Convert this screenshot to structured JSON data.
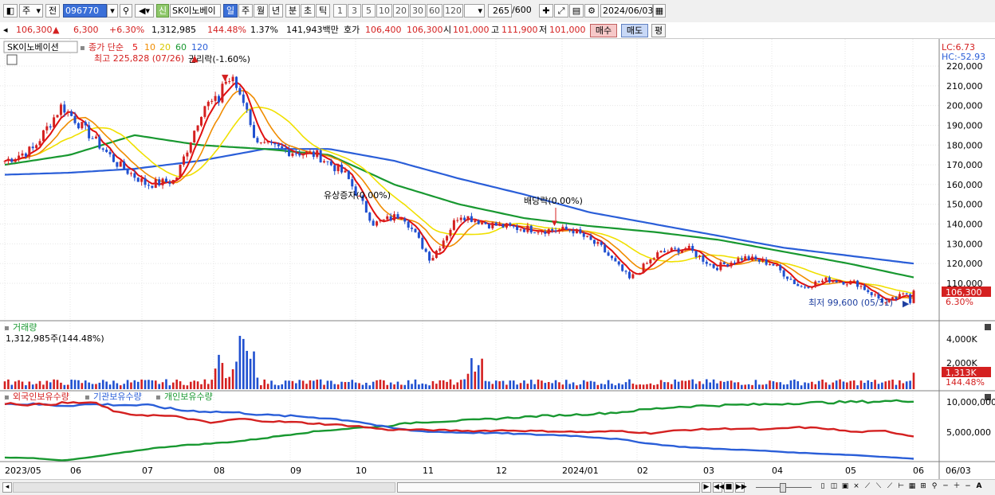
{
  "toolbar": {
    "period": "주",
    "prev_label": "전",
    "code": "096770",
    "new_label": "신",
    "stock_name": "SK이노베이",
    "tf_day": "일",
    "tf_week": "주",
    "tf_month": "월",
    "tf_year": "년",
    "tf_min": "분",
    "tf_sec": "초",
    "tf_tick": "틱",
    "nums": [
      "1",
      "3",
      "5",
      "10",
      "20",
      "30",
      "60",
      "120"
    ],
    "count": "265",
    "count_total": "/600",
    "date": "2024/06/03"
  },
  "info": {
    "price": "106,300",
    "arrow": "▲",
    "change": "6,300",
    "change_pct": "+6.30%",
    "volume": "1,312,985",
    "vol_ratio": "144.48%",
    "turnover": "1.37%",
    "amount": "141,943백만",
    "bid_label": "호가",
    "bid1": "106,400",
    "bid2": "106,300",
    "open_label": "시",
    "open": "101,000",
    "high_label": "고",
    "high": "111,900",
    "low_label": "저",
    "low": "101,000",
    "buy_label": "매수",
    "sell_label": "매도",
    "eval_label": "평"
  },
  "chart": {
    "name_tag": "SK이노베이션",
    "ma_label": "종가 단순",
    "ma_periods": [
      "5",
      "10",
      "20",
      "60",
      "120"
    ],
    "max_label": "최고 225,828 (07/26)",
    "ex_rights": "권리락(-1.60%)",
    "rights_issue": "유상증자(0.00%)",
    "ex_dividend": "배당락(0.00%)",
    "min_label": "최저 99,600 (05/31)",
    "lc": "LC:6.73",
    "hc": "HC:-52.93",
    "price_tag": "106,300",
    "pct_tag": "6.30%",
    "y_ticks": [
      "220,000",
      "210,000",
      "200,000",
      "190,000",
      "180,000",
      "170,000",
      "160,000",
      "150,000",
      "140,000",
      "130,000",
      "120,000",
      "110,000"
    ],
    "volume_title": "거래량",
    "volume_value": "1,312,985주(144.48%)",
    "vol_ticks": [
      "4,000K",
      "2,000K"
    ],
    "vol_tag": "1,313K",
    "vol_pct_tag": "144.48%",
    "inv_title1": "외국인보유수량",
    "inv_title2": "기관보유수량",
    "inv_title3": "개인보유수량",
    "inv_ticks": [
      "10,000,000",
      "5,000,000"
    ],
    "x_labels": [
      "2023/05",
      "06",
      "07",
      "08",
      "09",
      "10",
      "11",
      "12",
      "2024/01",
      "02",
      "03",
      "04",
      "05",
      "06"
    ],
    "x_right": "06/03",
    "colors": {
      "up": "#d42020",
      "down": "#2050d0",
      "ma5": "#e01010",
      "ma10": "#f08c00",
      "ma20": "#f0e000",
      "ma60": "#189830",
      "ma120": "#2a5ed8"
    }
  },
  "chart_data": {
    "type": "candlestick",
    "x_labels": [
      "2023/05",
      "06",
      "07",
      "08",
      "09",
      "10",
      "11",
      "12",
      "2024/01",
      "02",
      "03",
      "04",
      "05",
      "06"
    ],
    "ylim": [
      100000,
      225000
    ],
    "high": 225828,
    "high_date": "07/26",
    "low": 99600,
    "low_date": "05/31",
    "close_trend": [
      172000,
      178000,
      200000,
      185000,
      170000,
      160000,
      162000,
      200000,
      205000,
      180000,
      177000,
      175000,
      165000,
      140000,
      145000,
      122000,
      145000,
      140000,
      138000,
      137000,
      137000,
      128000,
      112000,
      125000,
      128000,
      118000,
      123000,
      120000,
      108000,
      112000,
      110000,
      100000,
      106300
    ],
    "ma120_trend": [
      165000,
      166000,
      168000,
      172000,
      178000,
      178000,
      172000,
      163000,
      155000,
      146000,
      140000,
      134000,
      128000,
      124000,
      120000
    ],
    "ma60_trend": [
      170000,
      175000,
      185000,
      180000,
      178000,
      175000,
      160000,
      150000,
      143000,
      139000,
      136000,
      132000,
      126000,
      120000,
      113000
    ],
    "volume_k": {
      "max_tick": 4000,
      "last": 1313
    },
    "investors": {
      "series": [
        {
          "name": "외국인보유수량",
          "color": "#d42020"
        },
        {
          "name": "기관보유수량",
          "color": "#2a5ed8"
        },
        {
          "name": "개인보유수량",
          "color": "#189830"
        }
      ]
    }
  }
}
